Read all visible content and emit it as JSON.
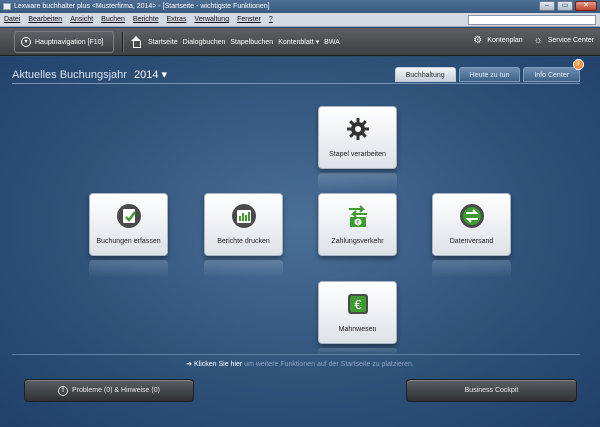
{
  "window": {
    "title": "Lexware buchhalter plus <Musterfirma, 2014> - [Startseite - wichtigste Funktionen]",
    "minimize": "–",
    "maximize": "▭",
    "close": "✕"
  },
  "menu": [
    "Datei",
    "Bearbeiten",
    "Ansicht",
    "Buchen",
    "Berichte",
    "Extras",
    "Verwaltung",
    "Fenster",
    "?"
  ],
  "nav": {
    "haupt_label": "Hauptnavigation [F10]",
    "links": [
      "Startseite",
      "Dialogbuchen",
      "Stapelbuchen",
      "Kontenblatt ▾",
      "BWA"
    ],
    "kontenplan": "Kontenplan",
    "service": "Service Center"
  },
  "header": {
    "year_label": "Aktuelles Buchungsjahr",
    "year_value": "2014 ▾"
  },
  "tabs": [
    {
      "label": "Buchhaltung",
      "active": true
    },
    {
      "label": "Heute zu tun",
      "active": false
    },
    {
      "label": "Info Center",
      "active": false,
      "badge": "!"
    }
  ],
  "tiles": {
    "stapel": "Stapel verarbeiten",
    "buchungen": "Buchungen erfassen",
    "berichte": "Berichte drucken",
    "zahlung": "Zahlungsverkehr",
    "datenversand": "Datenversand",
    "mahnwesen": "Mahnwesen"
  },
  "hint": {
    "arrow": "➔",
    "link": "Klicken Sie hier",
    "rest": " um weitere Funktionen auf der Startseite zu platzieren."
  },
  "bottom": {
    "probleme": "Probleme (0) & Hinweise (0)",
    "cockpit": "Business Cockpit"
  },
  "colors": {
    "accent_green": "#3e9b2f",
    "background": "#2f5279"
  }
}
